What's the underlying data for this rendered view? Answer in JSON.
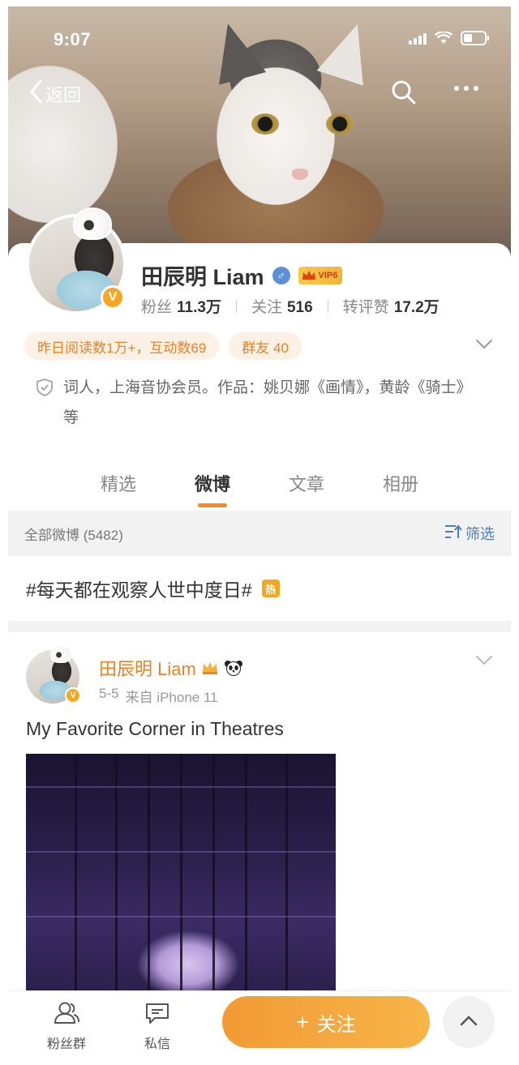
{
  "status_bar": {
    "time": "9:07"
  },
  "nav": {
    "back_label": "返回"
  },
  "profile": {
    "name": "田辰明 Liam",
    "vip_label": "VIP6",
    "stats": [
      {
        "label": "粉丝",
        "value": "11.3万"
      },
      {
        "label": "关注",
        "value": "516"
      },
      {
        "label": "转评赞",
        "value": "17.2万"
      }
    ],
    "tags": [
      {
        "label": "昨日阅读数1万+，互动数69"
      },
      {
        "label": "群友 40"
      }
    ],
    "bio": "词人，上海音协会员。作品：姚贝娜《画情》，黄龄《骑士》等"
  },
  "tabs": [
    {
      "label": "精选",
      "active": false
    },
    {
      "label": "微博",
      "active": true
    },
    {
      "label": "文章",
      "active": false
    },
    {
      "label": "相册",
      "active": false
    }
  ],
  "filter": {
    "count_label": "全部微博 (5482)",
    "filter_label": "筛选"
  },
  "hashtag": {
    "text": "#每天都在观察人世中度日#",
    "hot_label": "热"
  },
  "post": {
    "author": "田辰明 Liam",
    "date": "5-5",
    "source": "来自 iPhone 11",
    "text": "My Favorite Corner in Theatres"
  },
  "bottom_bar": {
    "fans_group_label": "粉丝群",
    "message_label": "私信",
    "follow_label": "关注"
  },
  "colors": {
    "accent": "#f18b2f",
    "tag_bg": "#fdf1e6",
    "link_blue": "#4a7dbf",
    "verified": "#f5a623"
  }
}
